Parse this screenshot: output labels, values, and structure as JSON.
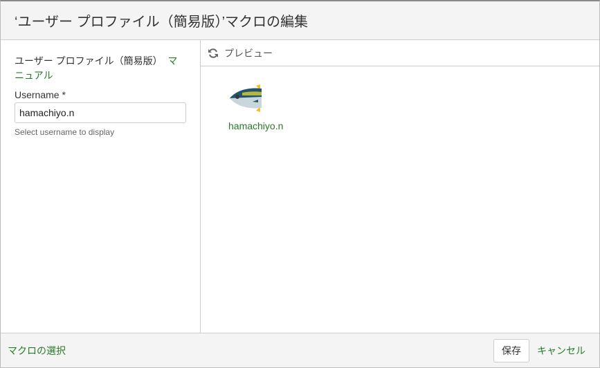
{
  "header": {
    "title": "‘ユーザー プロファイル（簡易版）’マクロの編集"
  },
  "left": {
    "macro_name": "ユーザー プロファイル（簡易版）",
    "manual_link": "マニュアル",
    "username_label": "Username *",
    "username_value": "hamachiyo.n",
    "help": "Select username to display"
  },
  "preview": {
    "label": "プレビュー",
    "user_name": "hamachiyo.n"
  },
  "footer": {
    "select_macro": "マクロの選択",
    "save": "保存",
    "cancel": "キャンセル"
  }
}
